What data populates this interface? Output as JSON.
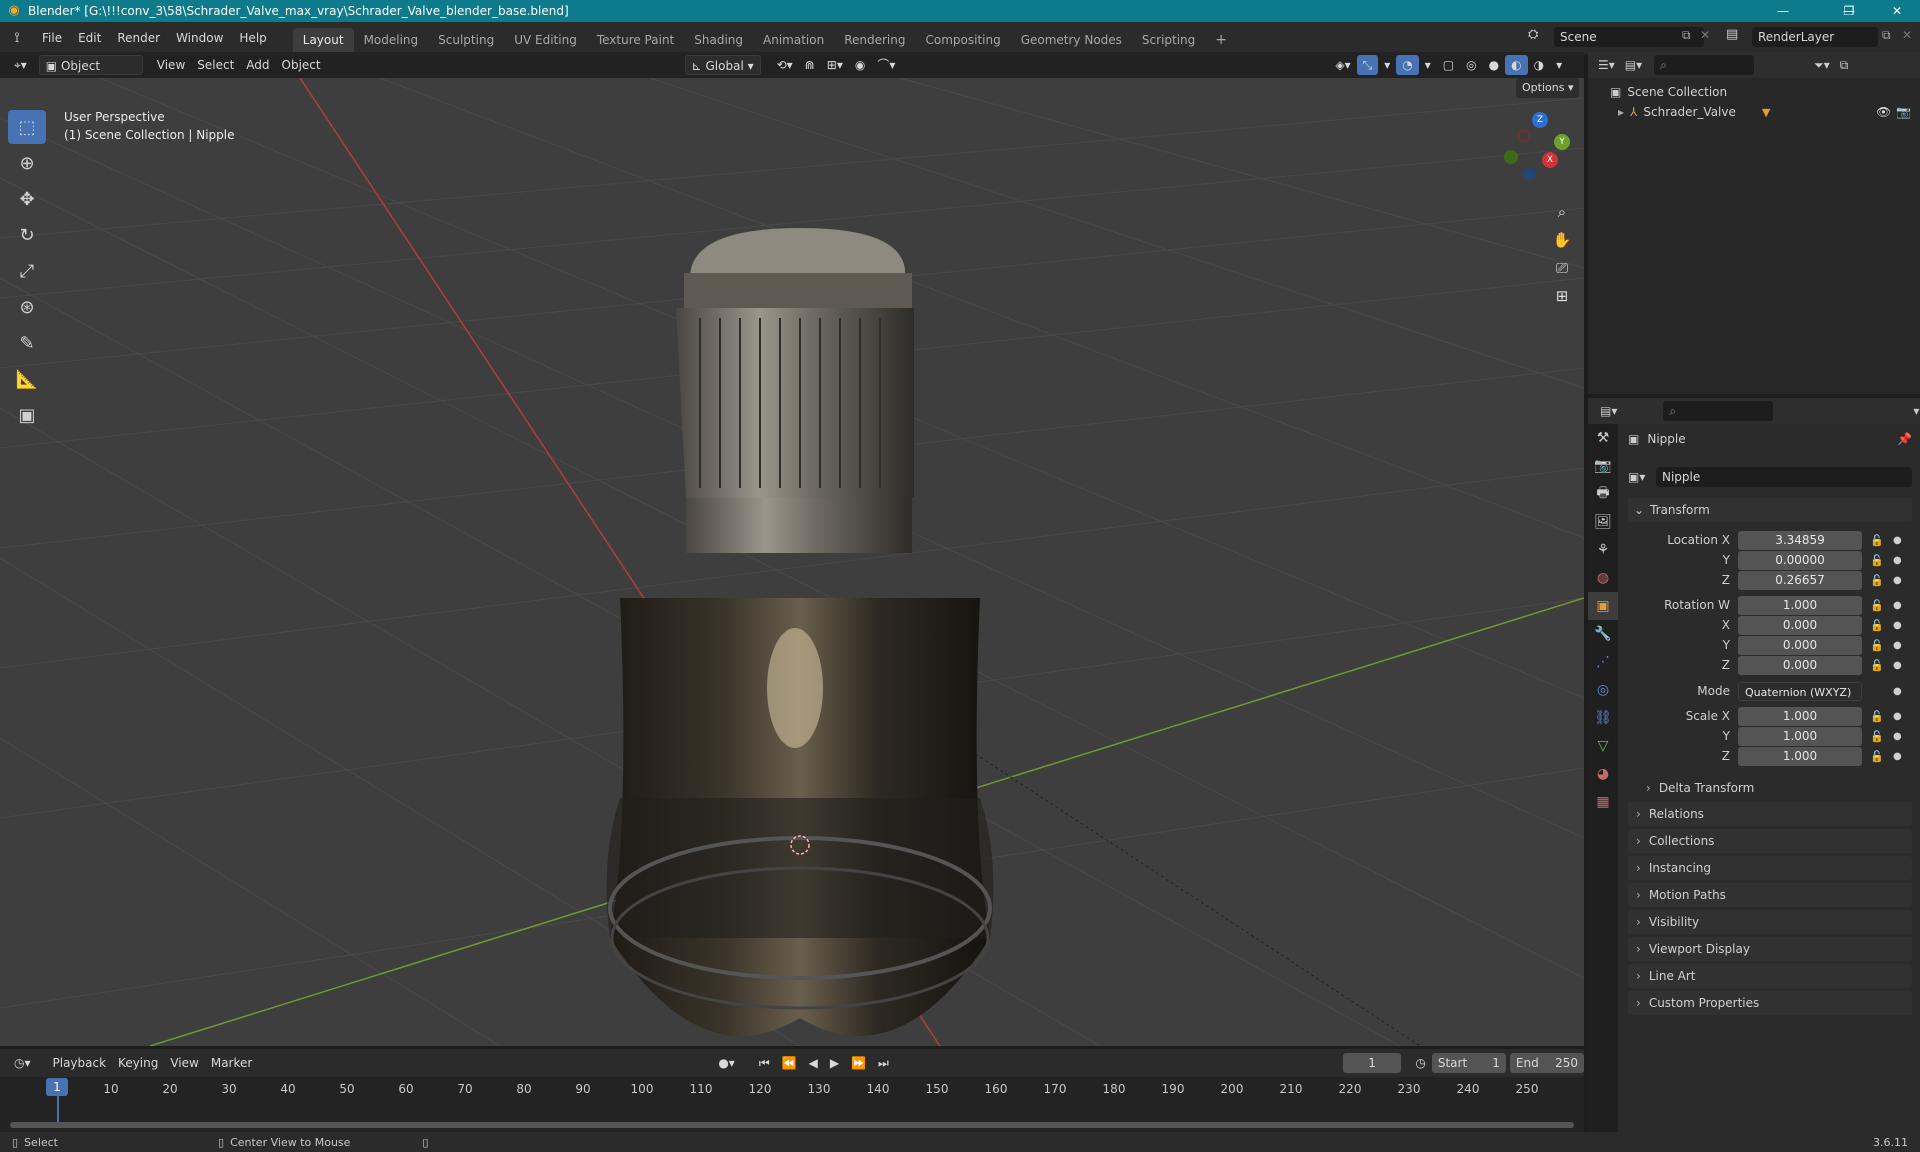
{
  "window": {
    "title": "Blender* [G:\\!!!conv_3\\58\\Schrader_Valve_max_vray\\Schrader_Valve_blender_base.blend]",
    "minimize": "—",
    "maximize": "❐",
    "close": "✕"
  },
  "menu": {
    "items": [
      "File",
      "Edit",
      "Render",
      "Window",
      "Help"
    ]
  },
  "workspaces": [
    "Layout",
    "Modeling",
    "Sculpting",
    "UV Editing",
    "Texture Paint",
    "Shading",
    "Animation",
    "Rendering",
    "Compositing",
    "Geometry Nodes",
    "Scripting"
  ],
  "active_workspace": "Layout",
  "add_workspace": "+",
  "scene": {
    "name": "Scene"
  },
  "render_layer": {
    "name": "RenderLayer"
  },
  "viewport_header": {
    "mode": "Object Mode",
    "menus": [
      "View",
      "Select",
      "Add",
      "Object"
    ],
    "orientation": "Global",
    "options": "Options"
  },
  "viewport": {
    "perspective": "User Perspective",
    "collection_info": "(1) Scene Collection | Nipple",
    "gizmo": {
      "z": "Z",
      "y": "Y",
      "x": "X"
    }
  },
  "outliner": {
    "root": "Scene Collection",
    "items": [
      {
        "name": "Schrader_Valve",
        "type": "empty"
      }
    ]
  },
  "properties": {
    "object_name": "Nipple",
    "datablock_name": "Nipple",
    "transform_title": "Transform",
    "location": {
      "label": "Location X",
      "x": "3.34859",
      "y": "0.00000",
      "z": "0.26657"
    },
    "rotation": {
      "label": "Rotation W",
      "w": "1.000",
      "x": "0.000",
      "y": "0.000",
      "z": "0.000"
    },
    "mode": {
      "label": "Mode",
      "value": "Quaternion (WXYZ)"
    },
    "scale": {
      "label": "Scale X",
      "x": "1.000",
      "y": "1.000",
      "z": "1.000"
    },
    "axis_labels": {
      "y": "Y",
      "z": "Z",
      "x": "X"
    },
    "delta_transform": "Delta Transform",
    "sections": [
      "Relations",
      "Collections",
      "Instancing",
      "Motion Paths",
      "Visibility",
      "Viewport Display",
      "Line Art",
      "Custom Properties"
    ]
  },
  "timeline": {
    "menus": [
      "Playback",
      "Keying",
      "View",
      "Marker"
    ],
    "current_frame": "1",
    "start_label": "Start",
    "start": "1",
    "end_label": "End",
    "end": "250",
    "ticks": [
      "10",
      "20",
      "30",
      "40",
      "50",
      "60",
      "70",
      "80",
      "90",
      "100",
      "110",
      "120",
      "130",
      "140",
      "150",
      "160",
      "170",
      "180",
      "190",
      "200",
      "210",
      "220",
      "230",
      "240",
      "250"
    ],
    "playhead": "1"
  },
  "statusbar": {
    "select": "Select",
    "center_view": "Center View to Mouse",
    "version": "3.6.11"
  }
}
